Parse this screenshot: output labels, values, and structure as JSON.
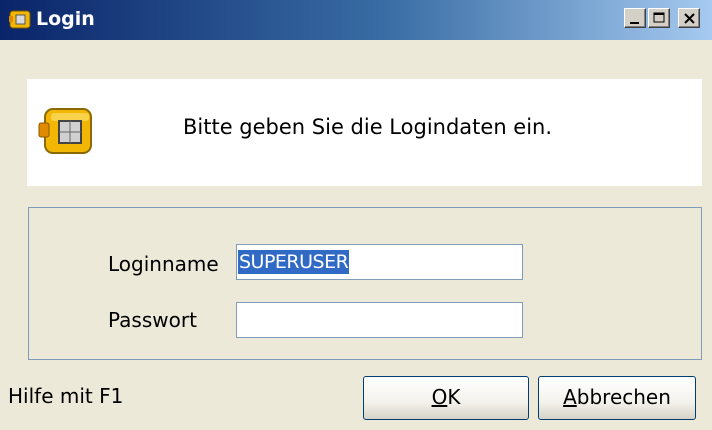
{
  "window": {
    "title": "Login",
    "icon": "package-icon",
    "controls": [
      "minimize-icon",
      "maximize-icon",
      "close-icon"
    ]
  },
  "header": {
    "icon": "package-icon",
    "message": "Bitte geben Sie die Logindaten ein."
  },
  "form": {
    "login_label": "Loginname",
    "login_value": "SUPERUSER",
    "password_label": "Passwort",
    "password_value": ""
  },
  "footer": {
    "help_text": "Hilfe mit F1",
    "ok_mnemonic": "O",
    "ok_rest": "K",
    "cancel_mnemonic": "A",
    "cancel_rest": "bbrechen"
  },
  "colors": {
    "titlebar_start": "#0a246a",
    "titlebar_end": "#a6caf0",
    "selection": "#316ac5",
    "dialog_bg": "#ece9d8"
  }
}
